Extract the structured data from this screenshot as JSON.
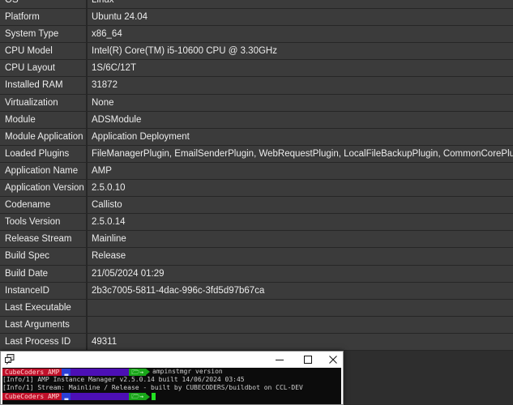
{
  "info_rows": [
    {
      "key": "OS",
      "value": "Linux"
    },
    {
      "key": "Platform",
      "value": "Ubuntu 24.04"
    },
    {
      "key": "System Type",
      "value": "x86_64"
    },
    {
      "key": "CPU Model",
      "value": "Intel(R) Core(TM) i5-10600 CPU @ 3.30GHz"
    },
    {
      "key": "CPU Layout",
      "value": "1S/6C/12T"
    },
    {
      "key": "Installed RAM",
      "value": "31872"
    },
    {
      "key": "Virtualization",
      "value": "None"
    },
    {
      "key": "Module",
      "value": "ADSModule"
    },
    {
      "key": "Module Application",
      "value": "Application Deployment"
    },
    {
      "key": "Loaded Plugins",
      "value": "FileManagerPlugin, EmailSenderPlugin, WebRequestPlugin, LocalFileBackupPlugin, CommonCorePlugin"
    },
    {
      "key": "Application Name",
      "value": "AMP"
    },
    {
      "key": "Application Version",
      "value": "2.5.0.10"
    },
    {
      "key": "Codename",
      "value": "Callisto"
    },
    {
      "key": "Tools Version",
      "value": "2.5.0.14"
    },
    {
      "key": "Release Stream",
      "value": "Mainline"
    },
    {
      "key": "Build Spec",
      "value": "Release"
    },
    {
      "key": "Build Date",
      "value": "21/05/2024 01:29"
    },
    {
      "key": "InstanceID",
      "value": "2b3c7005-5811-4dac-996c-3fd5d97b67ca"
    },
    {
      "key": "Last Executable",
      "value": ""
    },
    {
      "key": "Last Arguments",
      "value": ""
    },
    {
      "key": "Last Process ID",
      "value": "49311"
    }
  ],
  "terminal": {
    "prompt_label": "CubeCoders AMP",
    "command": "ampinstmgr version",
    "output_lines": [
      "[Info/1] AMP Instance Manager v2.5.0.14 built 14/06/2024 03:45",
      "[Info/1] Stream: Mainline / Release - built by CUBECODERS/buildbot on CCL-DEV"
    ],
    "dir_glyph": "🗁",
    "arrow_glyph": "→"
  },
  "colors": {
    "prompt_red": "#c0102a",
    "prompt_blue": "#2a3fd6",
    "prompt_purple": "#4c0fb5",
    "prompt_green": "#19a619",
    "cursor_green": "#23e023"
  }
}
